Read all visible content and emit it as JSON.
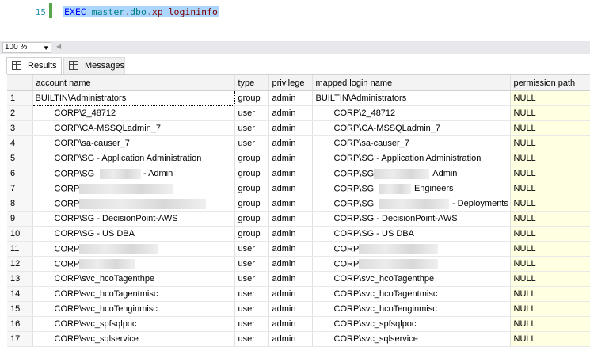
{
  "editor": {
    "line_prev": "-",
    "line_number": "15",
    "code": {
      "kw": "EXEC",
      "db": "master",
      "schema": "dbo",
      "proc": "xp_logininfo"
    }
  },
  "statusbar": {
    "zoom": "100 %"
  },
  "tabs": [
    {
      "label": "Results",
      "icon": "grid-icon"
    },
    {
      "label": "Messages",
      "icon": "messages-icon"
    }
  ],
  "grid": {
    "columns": [
      "account name",
      "type",
      "privilege",
      "mapped login name",
      "permission path"
    ],
    "rows": [
      {
        "n": "1",
        "account": "BUILTIN\\Administrators",
        "type": "group",
        "priv": "admin",
        "mapped": "BUILTIN\\Administrators",
        "path": "NULL"
      },
      {
        "n": "2",
        "account": "CORP\\2_48712",
        "type": "user",
        "priv": "admin",
        "mapped": "CORP\\2_48712",
        "path": "NULL"
      },
      {
        "n": "3",
        "account": "CORP\\CA-MSSQLadmin_7",
        "type": "user",
        "priv": "admin",
        "mapped": "CORP\\CA-MSSQLadmin_7",
        "path": "NULL"
      },
      {
        "n": "4",
        "account": "CORP\\sa-causer_7",
        "type": "user",
        "priv": "admin",
        "mapped": "CORP\\sa-causer_7",
        "path": "NULL"
      },
      {
        "n": "5",
        "account": "CORP\\SG - Application Administration",
        "type": "group",
        "priv": "admin",
        "mapped": "CORP\\SG - Application Administration",
        "path": "NULL"
      },
      {
        "n": "6",
        "account": "CORP\\SG -",
        "account_suffix": "- Admin",
        "type": "group",
        "priv": "admin",
        "mapped": "CORP\\SG",
        "mapped_suffix": "Admin",
        "path": "NULL"
      },
      {
        "n": "7",
        "account": "CORP",
        "type": "group",
        "priv": "admin",
        "mapped": "CORP\\SG -",
        "mapped_suffix": "Engineers",
        "path": "NULL"
      },
      {
        "n": "8",
        "account": "CORP",
        "type": "group",
        "priv": "admin",
        "mapped": "CORP\\SG -",
        "mapped_suffix": "- Deployments",
        "path": "NULL"
      },
      {
        "n": "9",
        "account": "CORP\\SG - DecisionPoint-AWS",
        "type": "group",
        "priv": "admin",
        "mapped": "CORP\\SG - DecisionPoint-AWS",
        "path": "NULL"
      },
      {
        "n": "10",
        "account": "CORP\\SG - US DBA",
        "type": "group",
        "priv": "admin",
        "mapped": "CORP\\SG - US DBA",
        "path": "NULL"
      },
      {
        "n": "11",
        "account": "CORP",
        "type": "user",
        "priv": "admin",
        "mapped": "CORP",
        "path": "NULL"
      },
      {
        "n": "12",
        "account": "CORP",
        "type": "user",
        "priv": "admin",
        "mapped": "CORP",
        "path": "NULL"
      },
      {
        "n": "13",
        "account": "CORP\\svc_hcoTagenthpe",
        "type": "user",
        "priv": "admin",
        "mapped": "CORP\\svc_hcoTagenthpe",
        "path": "NULL"
      },
      {
        "n": "14",
        "account": "CORP\\svc_hcoTagentmisc",
        "type": "user",
        "priv": "admin",
        "mapped": "CORP\\svc_hcoTagentmisc",
        "path": "NULL"
      },
      {
        "n": "15",
        "account": "CORP\\svc_hcoTenginmisc",
        "type": "user",
        "priv": "admin",
        "mapped": "CORP\\svc_hcoTenginmisc",
        "path": "NULL"
      },
      {
        "n": "16",
        "account": "CORP\\svc_spfsqlpoc",
        "type": "user",
        "priv": "admin",
        "mapped": "CORP\\svc_spfsqlpoc",
        "path": "NULL"
      },
      {
        "n": "17",
        "account": "CORP\\svc_sqlservice",
        "type": "user",
        "priv": "admin",
        "mapped": "CORP\\svc_sqlservice",
        "path": "NULL"
      }
    ]
  }
}
